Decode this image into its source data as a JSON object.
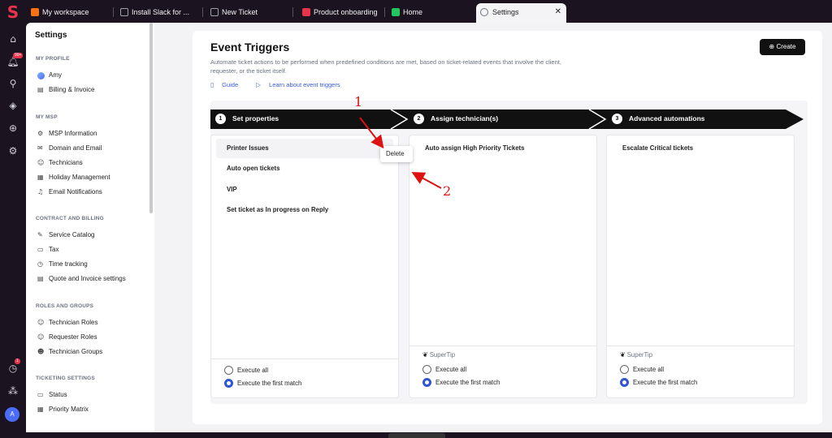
{
  "tabs": [
    {
      "label": "My workspace",
      "color": "#f97316"
    },
    {
      "label": "Install Slack for ...",
      "color": "#9ca3af"
    },
    {
      "label": "New Ticket",
      "color": "#9ca3af"
    },
    {
      "label": "Product onboarding",
      "color": "#e8344a"
    },
    {
      "label": "Home",
      "color": "#22c55e"
    },
    {
      "label": "Settings",
      "color": "#6b7280"
    }
  ],
  "rail_badges": {
    "notifications": "99+",
    "tasks": "1"
  },
  "rail_avatar": "A",
  "sidebar": {
    "title": "Settings",
    "sections": [
      {
        "label": "MY PROFILE",
        "items": [
          {
            "label": "Amy",
            "icon": "avatar"
          },
          {
            "label": "Billing & Invoice",
            "icon": "invoice-icon"
          }
        ]
      },
      {
        "label": "MY MSP",
        "items": [
          {
            "label": "MSP Information",
            "icon": "gear-icon"
          },
          {
            "label": "Domain and Email",
            "icon": "mail-icon"
          },
          {
            "label": "Technicians",
            "icon": "users-icon"
          },
          {
            "label": "Holiday Management",
            "icon": "calendar-icon"
          },
          {
            "label": "Email Notifications",
            "icon": "bell-icon"
          }
        ]
      },
      {
        "label": "CONTRACT AND BILLING",
        "items": [
          {
            "label": "Service Catalog",
            "icon": "catalog-icon"
          },
          {
            "label": "Tax",
            "icon": "tax-icon"
          },
          {
            "label": "Time tracking",
            "icon": "clock-icon"
          },
          {
            "label": "Quote and Invoice settings",
            "icon": "quote-icon"
          }
        ]
      },
      {
        "label": "ROLES AND GROUPS",
        "items": [
          {
            "label": "Technician Roles",
            "icon": "role-icon"
          },
          {
            "label": "Requester Roles",
            "icon": "role-icon"
          },
          {
            "label": "Technician Groups",
            "icon": "group-icon"
          }
        ]
      },
      {
        "label": "TICKETING SETTINGS",
        "items": [
          {
            "label": "Status",
            "icon": "status-icon"
          },
          {
            "label": "Priority Matrix",
            "icon": "matrix-icon"
          }
        ]
      }
    ]
  },
  "page": {
    "title": "Event Triggers",
    "description": "Automate ticket actions to be performed when predefined conditions are met, based on ticket-related events that involve the client, requester, or the ticket itself.",
    "guide_link": "Guide",
    "video_link": "Learn about event triggers",
    "create_button": "Create"
  },
  "steps": [
    {
      "number": "1",
      "label": "Set properties"
    },
    {
      "number": "2",
      "label": "Assign technician(s)"
    },
    {
      "number": "3",
      "label": "Advanced automations"
    }
  ],
  "columns": [
    {
      "items": [
        "Printer Issues",
        "Auto open tickets",
        "VIP",
        "Set ticket as In progress on Reply"
      ],
      "supertip": "",
      "options": [
        "Execute all",
        "Execute the first match"
      ],
      "selected": 1
    },
    {
      "items": [
        "Auto assign High Priority Tickets"
      ],
      "supertip": "SuperTip",
      "options": [
        "Execute all",
        "Execute the first match"
      ],
      "selected": 1
    },
    {
      "items": [
        "Escalate Critical tickets"
      ],
      "supertip": "SuperTip",
      "options": [
        "Execute all",
        "Execute the first match"
      ],
      "selected": 1
    }
  ],
  "context_menu": {
    "delete_label": "Delete"
  },
  "annotations": [
    "1",
    "2"
  ]
}
